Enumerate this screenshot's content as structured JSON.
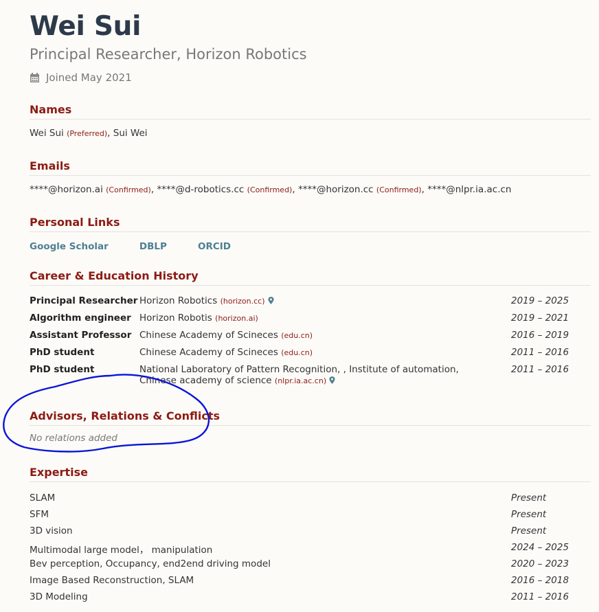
{
  "profile": {
    "name": "Wei Sui",
    "title": "Principal Researcher, Horizon Robotics",
    "joined": "Joined May 2021"
  },
  "names": {
    "heading": "Names",
    "primary": "Wei Sui",
    "primary_tag": "(Preferred)",
    "separator": ", ",
    "other": "Sui Wei"
  },
  "emails": {
    "heading": "Emails",
    "items": [
      {
        "address": "****@horizon.ai",
        "tag": "(Confirmed)"
      },
      {
        "address": "****@d-robotics.cc",
        "tag": "(Confirmed)"
      },
      {
        "address": "****@horizon.cc",
        "tag": "(Confirmed)"
      },
      {
        "address": "****@nlpr.ia.ac.cn",
        "tag": ""
      }
    ]
  },
  "links": {
    "heading": "Personal Links",
    "items": [
      "Google Scholar",
      "DBLP",
      "ORCID"
    ]
  },
  "history": {
    "heading": "Career & Education History",
    "rows": [
      {
        "position": "Principal Researcher",
        "institution": "Horizon Robotics",
        "domain": "(horizon.cc)",
        "pin": true,
        "years": "2019 – 2025"
      },
      {
        "position": "Algorithm engineer",
        "institution": "Horizon Robotis",
        "domain": "(horizon.ai)",
        "pin": false,
        "years": "2019 – 2021"
      },
      {
        "position": "Assistant Professor",
        "institution": "Chinese Academy of Scineces",
        "domain": "(edu.cn)",
        "pin": false,
        "years": "2016 – 2019"
      },
      {
        "position": "PhD student",
        "institution": "Chinese Academy of Scineces",
        "domain": "(edu.cn)",
        "pin": false,
        "years": "2011 – 2016"
      },
      {
        "position": "PhD student",
        "institution": "National Laboratory of Pattern Recognition, , Institute of automation, Chinese academy of science",
        "domain": "(nlpr.ia.ac.cn)",
        "pin": true,
        "years": "2011 – 2016"
      }
    ]
  },
  "relations": {
    "heading": "Advisors, Relations & Conflicts",
    "empty": "No relations added"
  },
  "expertise": {
    "heading": "Expertise",
    "rows": [
      {
        "topic": "SLAM",
        "years": "Present"
      },
      {
        "topic": "SFM",
        "years": "Present"
      },
      {
        "topic": "3D vision",
        "years": "Present"
      },
      {
        "topic": "Multimodal large model，  manipulation",
        "years": "2024 – 2025"
      },
      {
        "topic": "Bev perception, Occupancy, end2end driving model",
        "years": "2020 – 2023"
      },
      {
        "topic": "Image Based Reconstruction, SLAM",
        "years": "2016 – 2018"
      },
      {
        "topic": "3D Modeling",
        "years": "2011 – 2016"
      }
    ]
  },
  "colors": {
    "heading": "#8c1b13",
    "link": "#4d8093",
    "annotation": "#0a14d8"
  }
}
